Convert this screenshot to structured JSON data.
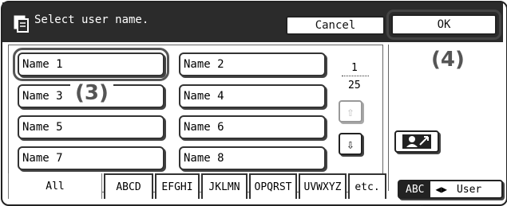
{
  "header": {
    "title": "Select user name.",
    "icon": "document-icon",
    "cancel_label": "Cancel",
    "ok_label": "OK"
  },
  "names": [
    {
      "label": "Name 1"
    },
    {
      "label": "Name 2"
    },
    {
      "label": "Name 3"
    },
    {
      "label": "Name 4"
    },
    {
      "label": "Name 5"
    },
    {
      "label": "Name 6"
    },
    {
      "label": "Name 7"
    },
    {
      "label": "Name 8"
    }
  ],
  "pager": {
    "current": "1",
    "total": "25"
  },
  "callouts": {
    "three": "(3)",
    "four": "(4)"
  },
  "tabs": [
    "All",
    "ABCD",
    "EFGHI",
    "JKLMN",
    "OPQRST",
    "UVWXYZ",
    "etc."
  ],
  "mode_toggle": {
    "active": "ABC",
    "inactive": "User"
  }
}
